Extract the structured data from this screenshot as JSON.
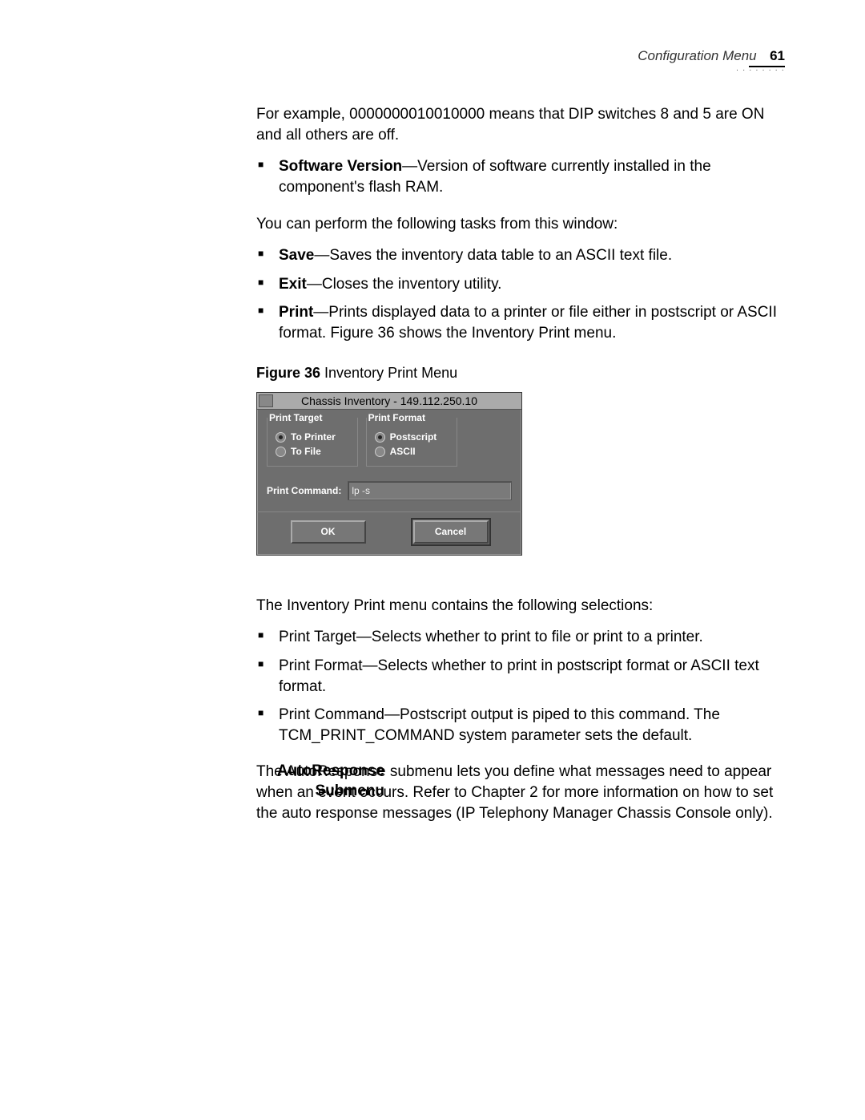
{
  "header": {
    "section_title": "Configuration Menu",
    "page_number": "61"
  },
  "body": {
    "dip_example": "For example, 0000000010010000 means that DIP switches 8 and 5 are ON and all others are off.",
    "sw_version_label": "Software Version",
    "sw_version_text": "—Version of software currently installed in the component's flash RAM.",
    "tasks_intro": "You can perform the following tasks from this window:",
    "task_save_label": "Save",
    "task_save_text": "—Saves the inventory data table to an ASCII text file.",
    "task_exit_label": "Exit",
    "task_exit_text": "—Closes the inventory utility.",
    "task_print_label": "Print",
    "task_print_text": "—Prints displayed data to a printer or file either in postscript or ASCII format. Figure 36 shows the Inventory Print menu.",
    "figure_label": "Figure 36",
    "figure_caption": "  Inventory Print Menu",
    "after_figure_intro": "The Inventory Print menu contains the following selections:",
    "sel_target": "Print Target—Selects whether to print to file or print to a printer.",
    "sel_format": "Print Format—Selects whether to print in postscript format or ASCII text format.",
    "sel_command": "Print Command—Postscript output is piped to this command. The TCM_PRINT_COMMAND system parameter sets the default.",
    "autoresp_heading": "AutoResponse Submenu",
    "autoresp_text": "The AutoResponse submenu lets you define what messages need to appear when an event occurs. Refer to Chapter 2 for more information on how to set the auto response messages (IP Telephony Manager Chassis Console only)."
  },
  "dialog": {
    "title": "Chassis Inventory - 149.112.250.10",
    "group_target": "Print Target",
    "target_opt1": "To Printer",
    "target_opt2": "To File",
    "group_format": "Print Format",
    "format_opt1": "Postscript",
    "format_opt2": "ASCII",
    "cmd_label": "Print Command:",
    "cmd_value": "lp -s",
    "ok": "OK",
    "cancel": "Cancel"
  }
}
